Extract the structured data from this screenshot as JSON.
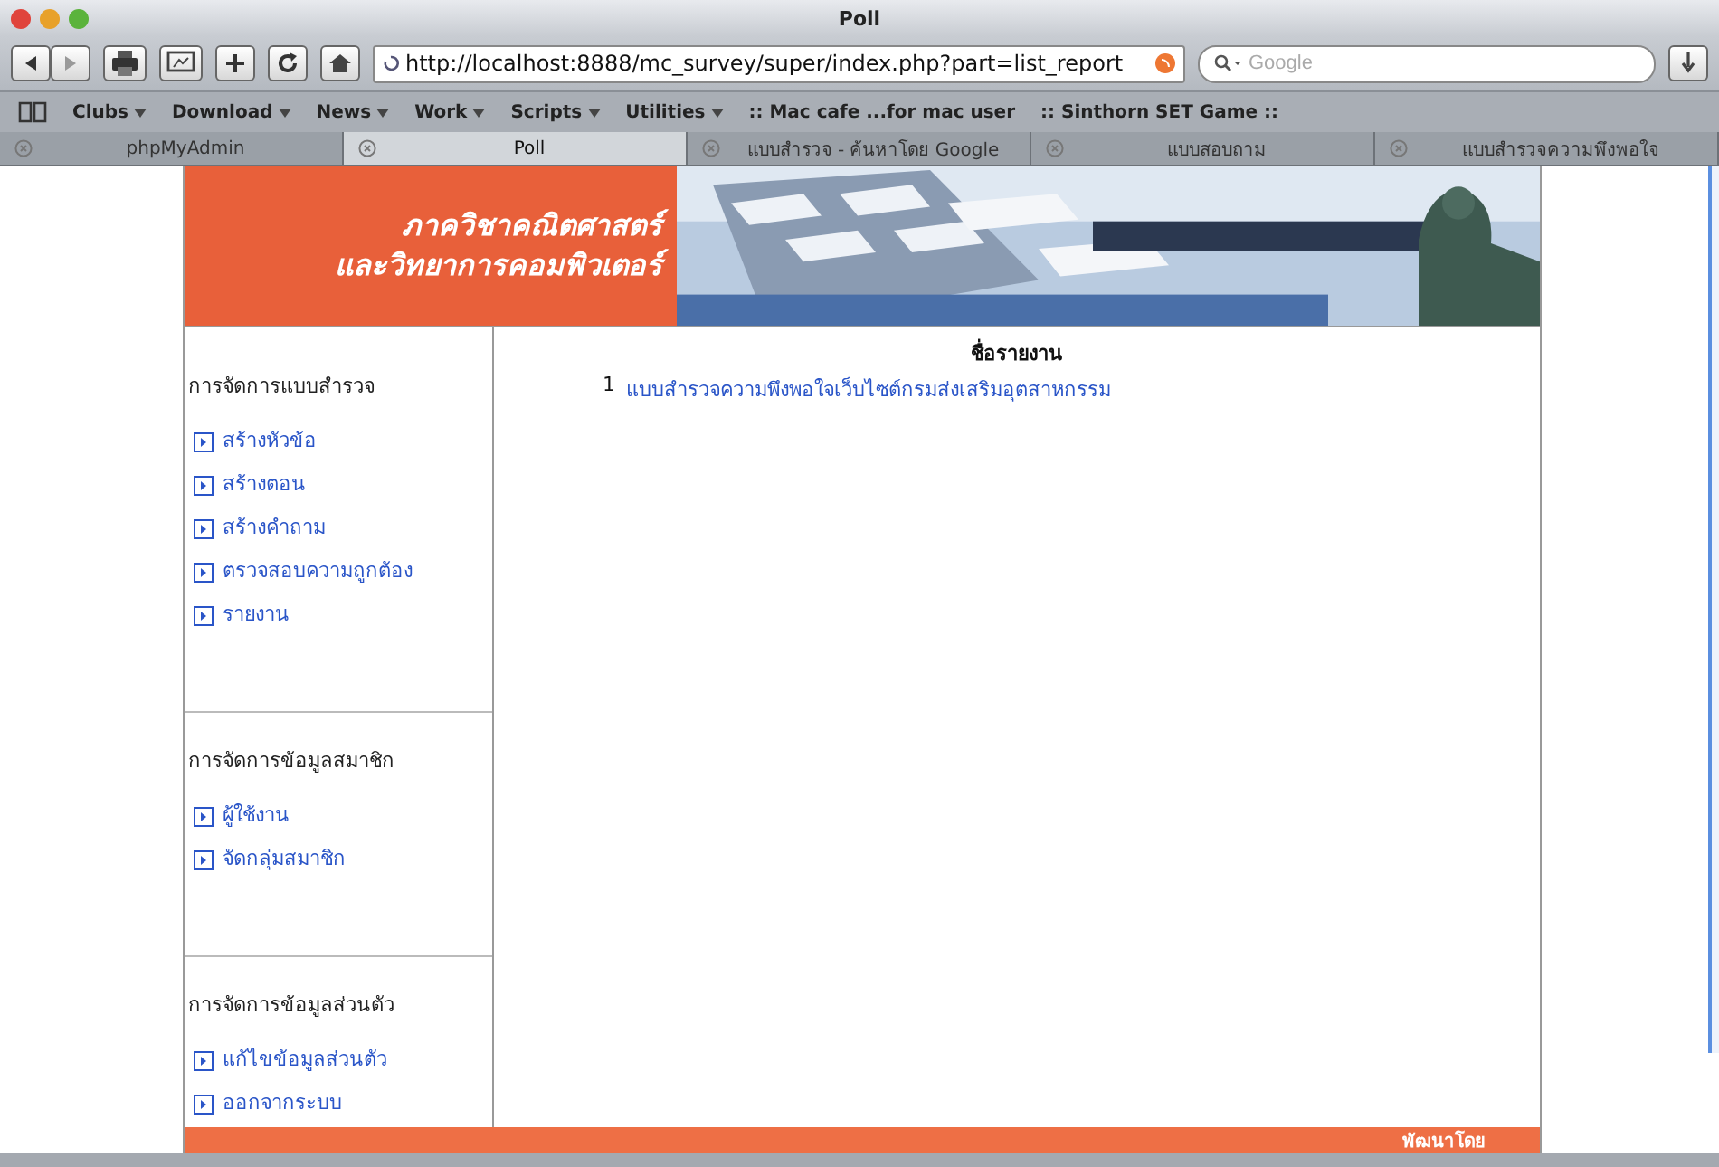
{
  "window": {
    "title": "Poll"
  },
  "address_bar": {
    "value": "http://localhost:8888/mc_survey/super/index.php?part=list_report"
  },
  "search": {
    "placeholder": "Google"
  },
  "bookmarks": [
    {
      "label": "Clubs",
      "menu": true
    },
    {
      "label": "Download",
      "menu": true
    },
    {
      "label": "News",
      "menu": true
    },
    {
      "label": "Work",
      "menu": true
    },
    {
      "label": "Scripts",
      "menu": true
    },
    {
      "label": "Utilities",
      "menu": true
    },
    {
      "label": ":: Mac cafe ...for mac user",
      "menu": false
    },
    {
      "label": ":: Sinthorn SET Game ::",
      "menu": false
    }
  ],
  "tabs": [
    {
      "label": "phpMyAdmin",
      "selected": false
    },
    {
      "label": "Poll",
      "selected": true
    },
    {
      "label": "แบบสำรวจ - ค้นหาโดย Google",
      "selected": false
    },
    {
      "label": "แบบสอบถาม",
      "selected": false
    },
    {
      "label": "แบบสำรวจความพึงพอใจ",
      "selected": false
    }
  ],
  "banner": {
    "lines": [
      "ภาควิชาคณิตศาสตร์",
      "และวิทยาการคอมพิวเตอร์"
    ]
  },
  "sidebar": {
    "sections": [
      {
        "title": "การจัดการแบบสำรวจ",
        "items": [
          "สร้างหัวข้อ",
          "สร้างตอน",
          "สร้างคำถาม",
          "ตรวจสอบความถูกต้อง",
          "รายงาน"
        ]
      },
      {
        "title": "การจัดการข้อมูลสมาชิก",
        "items": [
          "ผู้ใช้งาน",
          "จัดกลุ่มสมาชิก"
        ]
      },
      {
        "title": "การจัดการข้อมูลส่วนตัว",
        "items": [
          "แก้ไขข้อมูลส่วนตัว",
          "ออกจากระบบ"
        ]
      }
    ]
  },
  "report_table": {
    "heading": "ชื่อรายงาน",
    "rows": [
      {
        "number": "1",
        "name": "แบบสำรวจความพึงพอใจเว็บไซต์กรมส่งเสริมอุตสาหกรรม"
      }
    ]
  },
  "footer": {
    "text": "พัฒนาโดย"
  }
}
